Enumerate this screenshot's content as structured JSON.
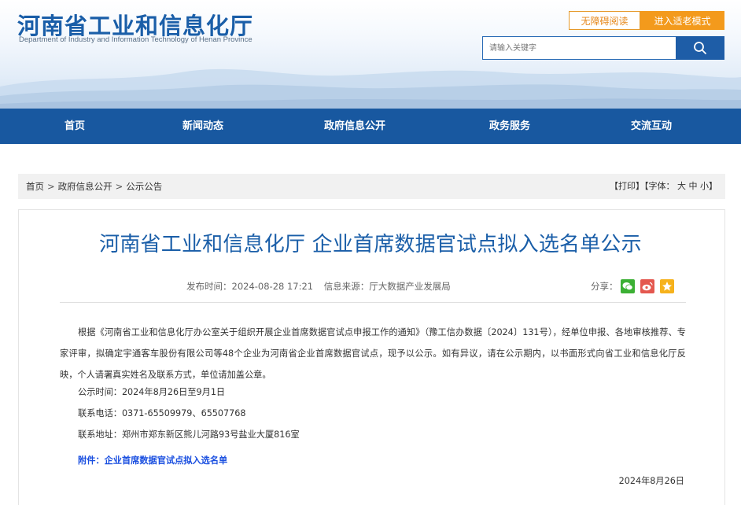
{
  "header": {
    "title": "河南省工业和信息化厅",
    "subtitle": "Department of Industry and Information Technology of Henan Province",
    "accessibility_label": "无障碍阅读",
    "elder_mode_label": "进入适老模式",
    "search_placeholder": "请输入关键字"
  },
  "nav": {
    "items": [
      {
        "label": "首页"
      },
      {
        "label": "新闻动态"
      },
      {
        "label": "政府信息公开"
      },
      {
        "label": "政务服务"
      },
      {
        "label": "交流互动"
      }
    ]
  },
  "breadcrumb": {
    "items": [
      "首页",
      "政府信息公开",
      "公示公告"
    ],
    "separator": ">"
  },
  "tools": {
    "print": "打印",
    "font_label": "字体：",
    "font_large": "大",
    "font_medium": "中",
    "font_small": "小"
  },
  "article": {
    "title": "河南省工业和信息化厅 企业首席数据官试点拟入选名单公示",
    "publish_time": "发布时间：2024-08-28 17:21",
    "source": "信息来源：厅大数据产业发展局",
    "share_label": "分享：",
    "share_icons": [
      "wechat-icon",
      "weibo-icon",
      "qzone-icon"
    ],
    "paragraph": "根据《河南省工业和信息化厅办公室关于组织开展企业首席数据官试点申报工作的通知》（豫工信办数据〔2024〕131号），经单位申报、各地审核推荐、专家评审，拟确定宇通客车股份有限公司等48个企业为河南省企业首席数据官试点，现予以公示。如有异议，请在公示期内，以书面形式向省工业和信息化厅反映，个人请署真实姓名及联系方式，单位请加盖公章。",
    "notice_period": "公示时间：2024年8月26日至9月1日",
    "phone": "联系电话：0371-65509979、65507768",
    "address": "联系地址：郑州市郑东新区熊儿河路93号盐业大厦816室",
    "attachment": "附件：企业首席数据官试点拟入选名单",
    "sign_date": "2024年8月26日"
  },
  "colors": {
    "brand_blue": "#1858a0",
    "title_blue": "#1a5ea8",
    "orange": "#f39a1c",
    "link_blue": "#1a4fe0"
  }
}
